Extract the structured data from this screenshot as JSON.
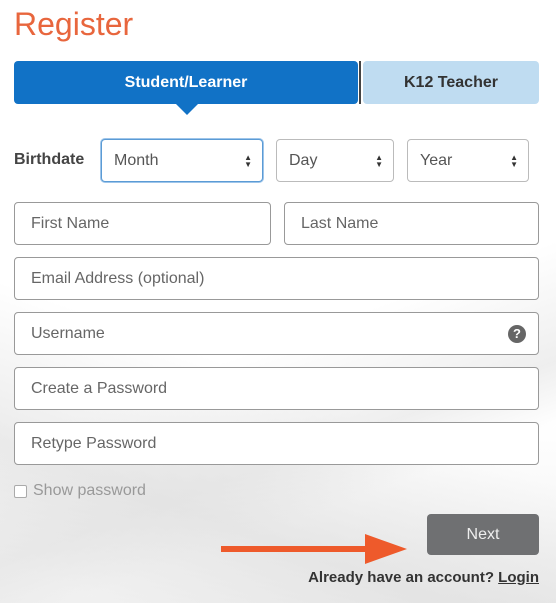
{
  "header": {
    "title": "Register"
  },
  "tabs": [
    {
      "label": "Student/Learner",
      "active": true
    },
    {
      "label": "K12 Teacher",
      "active": false
    }
  ],
  "birthdate": {
    "label": "Birthdate",
    "month": "Month",
    "day": "Day",
    "year": "Year"
  },
  "fields": {
    "first_name": "First Name",
    "last_name": "Last Name",
    "email": "Email Address (optional)",
    "username": "Username",
    "password": "Create a Password",
    "retype_password": "Retype Password"
  },
  "help_icon": "question-mark-icon",
  "show_password": "Show password",
  "next_button": "Next",
  "footer": {
    "prompt": "Already have an account?",
    "login_link": "Login"
  },
  "colors": {
    "title": "#e8663d",
    "active_tab": "#1172c6",
    "inactive_tab": "#bfdcf1",
    "next_button": "#6f7072",
    "annotation_arrow": "#ee5a2b"
  }
}
